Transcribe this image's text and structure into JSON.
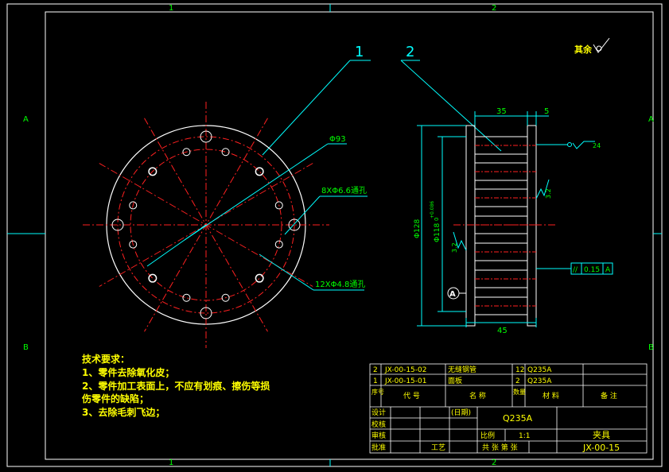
{
  "colors": {
    "background": "#000000",
    "frame": "#ffffff",
    "centerline": "#ff2020",
    "leader": "#00ffff",
    "dimension": "#00ffff",
    "text_yellow": "#ffff00",
    "text_green": "#00ff00",
    "part_white": "#ffffff"
  },
  "zones": {
    "top_1": "1",
    "top_2": "2",
    "left_a": "A",
    "left_b": "B",
    "right_a": "A",
    "right_b": "B",
    "bottom_1": "1",
    "bottom_2": "2"
  },
  "roughness_note": "其余",
  "balloons": {
    "b1": "1",
    "b2": "2"
  },
  "front_view": {
    "dia_label": "Φ93",
    "hole_label_1": "8XΦ6.6通孔",
    "hole_label_2": "12XΦ4.8通孔"
  },
  "section_view": {
    "dim_35": "35",
    "dim_5": "5",
    "dim_45": "45",
    "dim_128": "Φ128",
    "dim_118": "Φ118",
    "dim_118_tol": "+0.086",
    "dim_118_tol_low": "0",
    "rough_24": "24",
    "rough_32a": "3.2",
    "rough_32b": "3.2",
    "datum": "A",
    "fcf": [
      "//",
      "0.15",
      "A"
    ]
  },
  "tech_req": {
    "title": "技术要求：",
    "items": [
      "1、零件去除氧化皮；",
      "2、零件加工表面上，不应有划痕、擦伤等损",
      "伤零件的缺陷；",
      "3、去除毛刺飞边；"
    ]
  },
  "bom": [
    {
      "no": "2",
      "code": "JX-00-15-02",
      "name": "无缝钢管",
      "qty": "12",
      "material": "Q235A",
      "note": ""
    },
    {
      "no": "1",
      "code": "JX-00-15-01",
      "name": "面板",
      "qty": "2",
      "material": "Q235A",
      "note": ""
    }
  ],
  "bom_header": {
    "no": "序号",
    "code": "代 号",
    "name": "名 称",
    "qty": "数量",
    "material": "材 料",
    "note": "备 注"
  },
  "title_block": {
    "design": "设计",
    "check": "校核",
    "review": "审核",
    "approve": "批准",
    "date": "(日期)",
    "process": "工艺",
    "material": "Q235A",
    "scale_label": "比例",
    "scale": "1:1",
    "part_name": "夹具",
    "sheets": "共 张 第 张",
    "drawing_no": "JX-00-15"
  }
}
